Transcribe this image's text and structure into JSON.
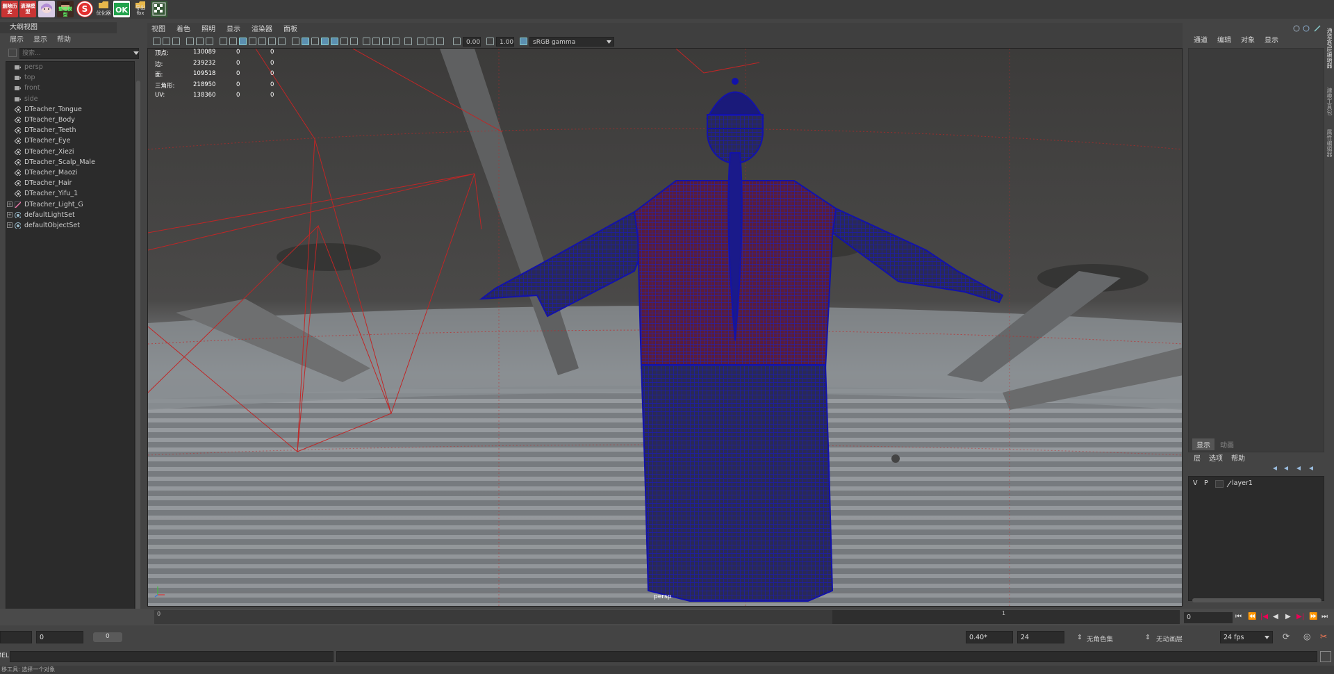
{
  "shelf": {
    "buttons": [
      {
        "label": "删除历史",
        "bg": "#d43b3b",
        "fg": "#fff"
      },
      {
        "label": "清理模型",
        "bg": "#d43b3b",
        "fg": "#fff"
      },
      {
        "label": "",
        "icon": "anime-avatar-icon",
        "bg": "#d8cbe5"
      },
      {
        "label": "整理模型",
        "icon": "character-face-icon",
        "bg": "#3e2a22"
      },
      {
        "label": "",
        "icon": "stop-sign-icon",
        "bg": "#e23030"
      },
      {
        "label": "优化器",
        "icon": "folder-icon",
        "bg": "#3c3c3c"
      },
      {
        "label": "OK",
        "icon": "ok-icon",
        "bg": "#21a24b"
      },
      {
        "label": "导出fbx",
        "icon": "folder-icon",
        "bg": "#3c3c3c"
      },
      {
        "label": "",
        "icon": "grid-checker-icon",
        "bg": "#4a6a4a"
      }
    ]
  },
  "outliner": {
    "title": "大纲视图",
    "menu": [
      "展示",
      "显示",
      "帮助"
    ],
    "search_placeholder": "搜索...",
    "items": [
      {
        "label": "persp",
        "type": "camera"
      },
      {
        "label": "top",
        "type": "camera"
      },
      {
        "label": "front",
        "type": "camera"
      },
      {
        "label": "side",
        "type": "camera"
      },
      {
        "label": "DTeacher_Tongue",
        "type": "mesh"
      },
      {
        "label": "DTeacher_Body",
        "type": "mesh"
      },
      {
        "label": "DTeacher_Teeth",
        "type": "mesh"
      },
      {
        "label": "DTeacher_Eye",
        "type": "mesh"
      },
      {
        "label": "DTeacher_Xiezi",
        "type": "mesh"
      },
      {
        "label": "DTeacher_Scalp_Male",
        "type": "mesh"
      },
      {
        "label": "DTeacher_Maozi",
        "type": "mesh"
      },
      {
        "label": "DTeacher_Hair",
        "type": "mesh"
      },
      {
        "label": "DTeacher_Yifu_1",
        "type": "mesh"
      },
      {
        "label": "DTeacher_Light_G",
        "type": "light-group"
      },
      {
        "label": "defaultLightSet",
        "type": "set"
      },
      {
        "label": "defaultObjectSet",
        "type": "set"
      }
    ]
  },
  "viewport": {
    "menu": [
      "视图",
      "着色",
      "照明",
      "显示",
      "渲染器",
      "面板"
    ],
    "exposure": "0.00",
    "gamma": "1.00",
    "color_space": "sRGB gamma",
    "camera": "persp",
    "hud": [
      {
        "label": "顶点:",
        "v1": "130089",
        "v2": "0",
        "v3": "0"
      },
      {
        "label": "边:",
        "v1": "239232",
        "v2": "0",
        "v3": "0"
      },
      {
        "label": "面:",
        "v1": "109518",
        "v2": "0",
        "v3": "0"
      },
      {
        "label": "三角形:",
        "v1": "218950",
        "v2": "0",
        "v3": "0"
      },
      {
        "label": "UV:",
        "v1": "138360",
        "v2": "0",
        "v3": "0"
      }
    ]
  },
  "channel_box": {
    "menu": [
      "通道",
      "编辑",
      "对象",
      "显示"
    ]
  },
  "layer_editor": {
    "tabs": [
      "显示",
      "动画"
    ],
    "menu": [
      "层",
      "选项",
      "帮助"
    ],
    "layer": {
      "v": "V",
      "p": "P",
      "name": "layer1"
    }
  },
  "side_tabs": [
    "通道盒/层编辑器",
    "建模工具包",
    "属性编辑器"
  ],
  "timeslider": {
    "start_tick": "0",
    "tick_label": "1",
    "current_frame": "0"
  },
  "rangebar": {
    "start": "0",
    "anim_start": "0",
    "range_field": "0",
    "playback_speed": "0.40*",
    "end": "24",
    "character_set": "无角色集",
    "anim_layer": "无动画层",
    "fps": "24 fps"
  },
  "cmdline": {
    "lang": "MEL"
  },
  "helpline": {
    "text": "移工具: 选择一个对象"
  }
}
